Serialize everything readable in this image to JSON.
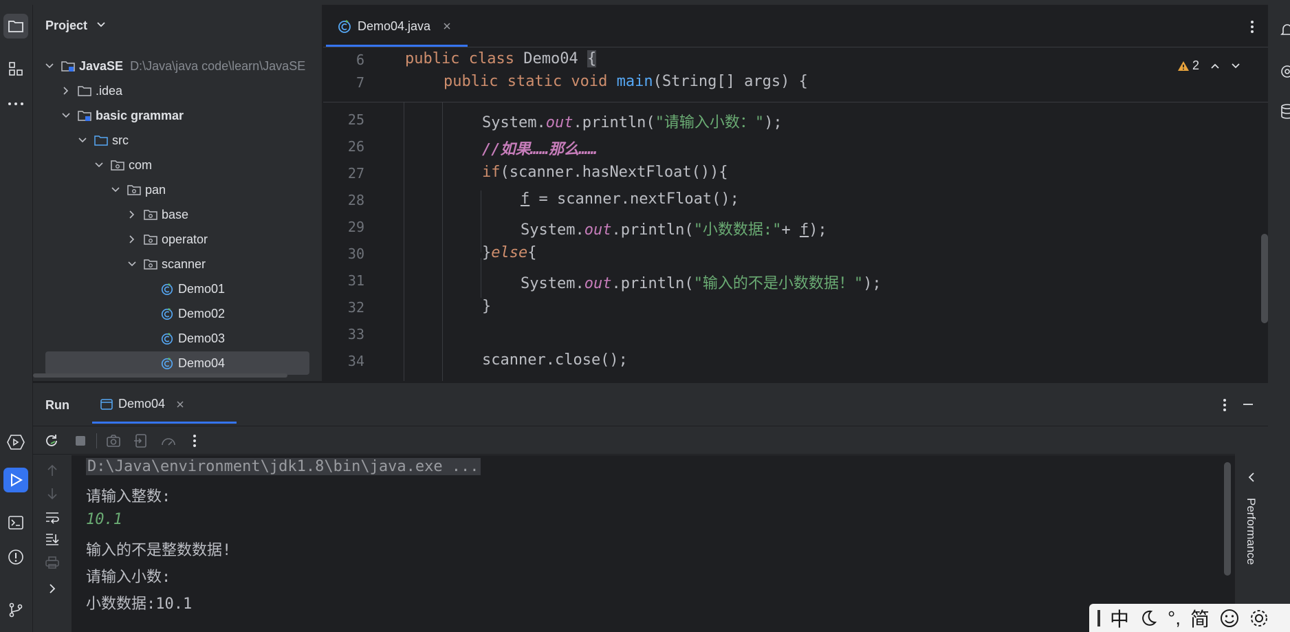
{
  "project_panel": {
    "title": "Project",
    "tree": [
      {
        "label": "JavaSE",
        "path": "D:\\Java\\java code\\learn\\JavaSE",
        "indent": 0,
        "expanded": true,
        "type": "module",
        "bold": true
      },
      {
        "label": ".idea",
        "indent": 1,
        "expanded": false,
        "type": "folder"
      },
      {
        "label": "basic grammar",
        "indent": 1,
        "expanded": true,
        "type": "module",
        "bold": true
      },
      {
        "label": "src",
        "indent": 2,
        "expanded": true,
        "type": "src-folder"
      },
      {
        "label": "com",
        "indent": 3,
        "expanded": true,
        "type": "package"
      },
      {
        "label": "pan",
        "indent": 4,
        "expanded": true,
        "type": "package"
      },
      {
        "label": "base",
        "indent": 5,
        "expanded": false,
        "type": "package"
      },
      {
        "label": "operator",
        "indent": 5,
        "expanded": false,
        "type": "package"
      },
      {
        "label": "scanner",
        "indent": 5,
        "expanded": true,
        "type": "package"
      },
      {
        "label": "Demo01",
        "indent": 6,
        "type": "class"
      },
      {
        "label": "Demo02",
        "indent": 6,
        "type": "class"
      },
      {
        "label": "Demo03",
        "indent": 6,
        "type": "class"
      },
      {
        "label": "Demo04",
        "indent": 6,
        "type": "class",
        "selected": true
      }
    ]
  },
  "editor": {
    "tab_label": "Demo04.java",
    "inspection_count": "2",
    "sticky_lines": [
      {
        "num": "6"
      },
      {
        "num": "7"
      }
    ],
    "line_numbers": [
      "25",
      "26",
      "27",
      "28",
      "29",
      "30",
      "31",
      "32",
      "33",
      "34"
    ],
    "code": {
      "l6_public": "public",
      "l6_class": "class",
      "l6_name": "Demo04",
      "l6_brace": "{",
      "l7_mods": "public static void",
      "l7_main": "main",
      "l7_rest": "(String[] args) {",
      "l25_a": "System.",
      "l25_out": "out",
      "l25_b": ".println(",
      "l25_str": "\"请输入小数：\"",
      "l25_c": ");",
      "l26_cmt": "//如果……那么……",
      "l27_if": "if",
      "l27_rest": "(scanner.hasNextFloat()){",
      "l28_f": "f",
      "l28_rest": " = scanner.nextFloat();",
      "l29_a": "System.",
      "l29_out": "out",
      "l29_b": ".println(",
      "l29_str": "\"小数数据:\"",
      "l29_plus": "+ ",
      "l29_f": "f",
      "l29_c": ");",
      "l30_a": "}",
      "l30_else": "else",
      "l30_b": "{",
      "l31_a": "System.",
      "l31_out": "out",
      "l31_b": ".println(",
      "l31_str": "\"输入的不是小数数据！\"",
      "l31_c": ");",
      "l32": "}",
      "l34": "scanner.close();"
    }
  },
  "run_panel": {
    "title": "Run",
    "tab_label": "Demo04",
    "console": {
      "cmd": "D:\\Java\\environment\\jdk1.8\\bin\\java.exe ...",
      "line1": "请输入整数:",
      "input1": "10.1",
      "line3": "输入的不是整数数据!",
      "line4": "请输入小数:",
      "line5": "小数数据:10.1"
    },
    "side_label": "Performance"
  },
  "ime": {
    "mode": "中",
    "punct": "°,",
    "charset": "简"
  },
  "colors": {
    "accent": "#3574f0",
    "keyword": "#cf8e6d",
    "function": "#56a8f5",
    "string": "#6aab73",
    "field": "#c77dbb"
  }
}
